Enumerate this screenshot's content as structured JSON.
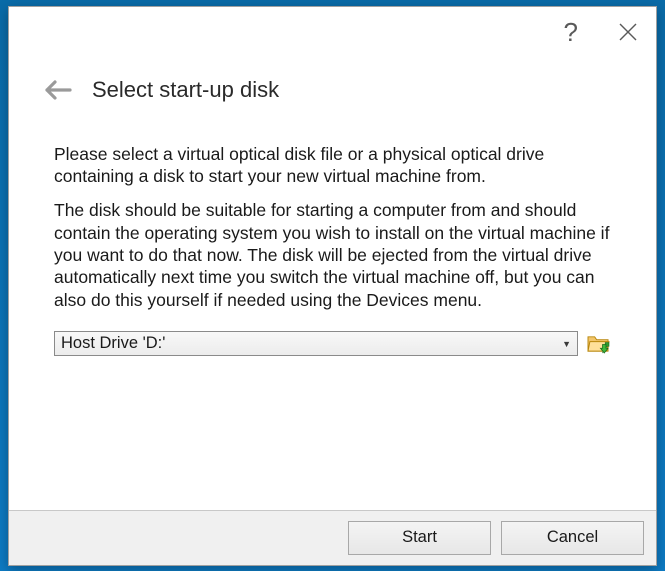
{
  "window": {
    "help_glyph": "?",
    "close_label": "Close"
  },
  "header": {
    "title": "Select start-up disk",
    "back_label": "Back"
  },
  "body": {
    "para1": "Please select a virtual optical disk file or a physical optical drive containing a disk to start your new virtual machine from.",
    "para2": "The disk should be suitable for starting a computer from and should contain the operating system you wish to install on the virtual machine if you want to do that now. The disk will be ejected from the virtual drive automatically next time you switch the virtual machine off, but you can also do this yourself if needed using the Devices menu."
  },
  "selector": {
    "selected": "Host Drive 'D:'",
    "browse_label": "Choose a virtual optical disk file..."
  },
  "buttons": {
    "start": "Start",
    "cancel": "Cancel"
  }
}
